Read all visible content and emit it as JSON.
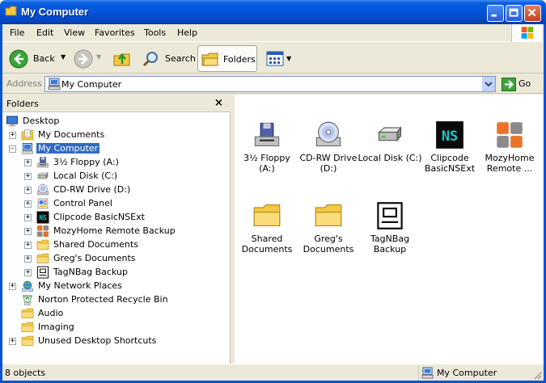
{
  "window": {
    "title": "My Computer"
  },
  "menubar": {
    "items": [
      "File",
      "Edit",
      "View",
      "Favorites",
      "Tools",
      "Help"
    ]
  },
  "toolbar": {
    "back_label": "Back",
    "search_label": "Search",
    "folders_label": "Folders"
  },
  "address": {
    "label": "Address",
    "value": "My Computer",
    "go_label": "Go"
  },
  "left_pane": {
    "title": "Folders",
    "tree": [
      {
        "label": "Desktop",
        "icon": "desktop-icon",
        "expander": ""
      },
      {
        "label": "My Documents",
        "icon": "my-documents-icon",
        "expander": "+"
      },
      {
        "label": "My Computer",
        "icon": "my-computer-icon",
        "expander": "-",
        "selected": true
      },
      {
        "label": "3½ Floppy (A:)",
        "icon": "floppy-icon",
        "expander": "+"
      },
      {
        "label": "Local Disk (C:)",
        "icon": "hard-disk-icon",
        "expander": "+"
      },
      {
        "label": "CD-RW Drive (D:)",
        "icon": "cd-drive-icon",
        "expander": "+"
      },
      {
        "label": "Control Panel",
        "icon": "control-panel-icon",
        "expander": "+"
      },
      {
        "label": "Clipcode BasicNSExt",
        "icon": "clipcode-icon",
        "expander": "+"
      },
      {
        "label": "MozyHome Remote Backup",
        "icon": "mozy-icon",
        "expander": "+"
      },
      {
        "label": "Shared Documents",
        "icon": "folder-icon",
        "expander": "+"
      },
      {
        "label": "Greg's Documents",
        "icon": "folder-icon",
        "expander": "+"
      },
      {
        "label": "TagNBag Backup",
        "icon": "tagnbag-icon",
        "expander": "+"
      },
      {
        "label": "My Network Places",
        "icon": "network-icon",
        "expander": "+"
      },
      {
        "label": "Norton Protected Recycle Bin",
        "icon": "recycle-bin-icon",
        "expander": ""
      },
      {
        "label": "Audio",
        "icon": "folder-icon",
        "expander": ""
      },
      {
        "label": "Imaging",
        "icon": "folder-icon",
        "expander": ""
      },
      {
        "label": "Unused Desktop Shortcuts",
        "icon": "folder-icon",
        "expander": "+"
      }
    ]
  },
  "right_pane": {
    "items": [
      {
        "label_line1": "3½ Floppy",
        "label_line2": "(A:)",
        "icon": "floppy-icon"
      },
      {
        "label_line1": "CD-RW Drive",
        "label_line2": "(D:)",
        "icon": "cd-drive-icon"
      },
      {
        "label_line1": "Local Disk (C:)",
        "label_line2": "",
        "icon": "hard-disk-icon"
      },
      {
        "label_line1": "Clipcode",
        "label_line2": "BasicNSExt",
        "icon": "clipcode-icon"
      },
      {
        "label_line1": "MozyHome",
        "label_line2": "Remote ...",
        "icon": "mozy-icon"
      },
      {
        "label_line1": "Shared",
        "label_line2": "Documents",
        "icon": "folder-icon"
      },
      {
        "label_line1": "Greg's",
        "label_line2": "Documents",
        "icon": "folder-icon"
      },
      {
        "label_line1": "TagNBag",
        "label_line2": "Backup",
        "icon": "tagnbag-icon"
      }
    ]
  },
  "status": {
    "count": "8 objects",
    "location": "My Computer"
  },
  "colors": {
    "title_blue": "#0553d8",
    "selection": "#316ac5",
    "chrome": "#ece9d8",
    "folder": "#f5c842"
  }
}
